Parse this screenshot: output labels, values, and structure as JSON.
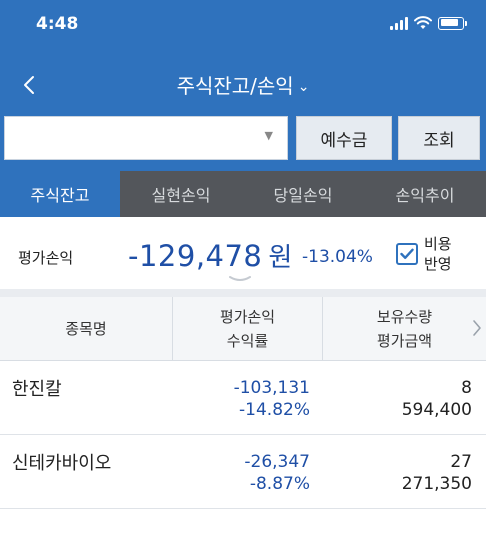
{
  "status": {
    "time": "4:48"
  },
  "header": {
    "title": "주식잔고/손익",
    "title_chevron": "⌄",
    "back_label": "<"
  },
  "account": {
    "value": "",
    "caret": "▼"
  },
  "buttons": {
    "deposit": "예수금",
    "query": "조회"
  },
  "tabs": [
    {
      "label": "주식잔고",
      "active": true
    },
    {
      "label": "실현손익",
      "active": false
    },
    {
      "label": "당일손익",
      "active": false
    },
    {
      "label": "손익추이",
      "active": false
    }
  ],
  "summary": {
    "label": "평가손익",
    "amount": "-129,478",
    "unit": "원",
    "rate": "-13.04%",
    "cost_checked": true,
    "cost_label_1": "비용",
    "cost_label_2": "반영"
  },
  "table": {
    "headers": {
      "name": "종목명",
      "pl_1": "평가손익",
      "pl_2": "수익률",
      "qty_1": "보유수량",
      "qty_2": "평가금액",
      "more": ">"
    },
    "rows": [
      {
        "name": "한진칼",
        "pl": "-103,131",
        "rate": "-14.82%",
        "qty": "8",
        "value": "594,400"
      },
      {
        "name": "신테카바이오",
        "pl": "-26,347",
        "rate": "-8.87%",
        "qty": "27",
        "value": "271,350"
      }
    ]
  },
  "colors": {
    "primary": "#2f72bd",
    "tab_bg": "#53565b",
    "negative": "#1f4fa6"
  }
}
